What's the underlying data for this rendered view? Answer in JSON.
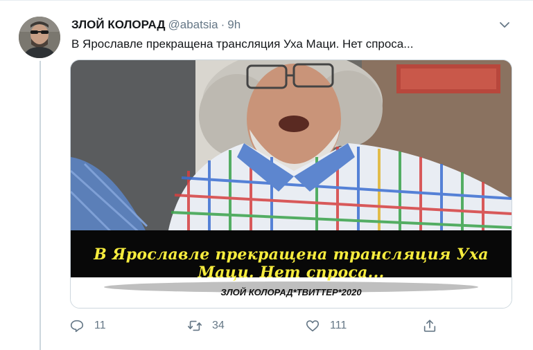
{
  "tweet": {
    "display_name": "ЗЛОЙ КОЛОРАД",
    "handle": "@abatsia",
    "separator": "·",
    "time": "9h",
    "text": "В Ярославле прекращена трансляция Уха Маци. Нет спроса...",
    "image": {
      "caption": "В Ярославле прекращена трансляция Уха Маци. Нет спроса...",
      "watermark": "ЗЛОЙ КОЛОРАД*ТВИТТЕР*2020"
    },
    "actions": {
      "reply_count": "11",
      "retweet_count": "34",
      "like_count": "111"
    }
  },
  "icons": {
    "more": "chevron-down-icon",
    "reply": "reply-icon",
    "retweet": "retweet-icon",
    "like": "heart-icon",
    "share": "share-icon"
  },
  "colors": {
    "icon_gray": "#657786",
    "caption_yellow": "#f6ec3d",
    "divider": "#e6ecf0"
  }
}
